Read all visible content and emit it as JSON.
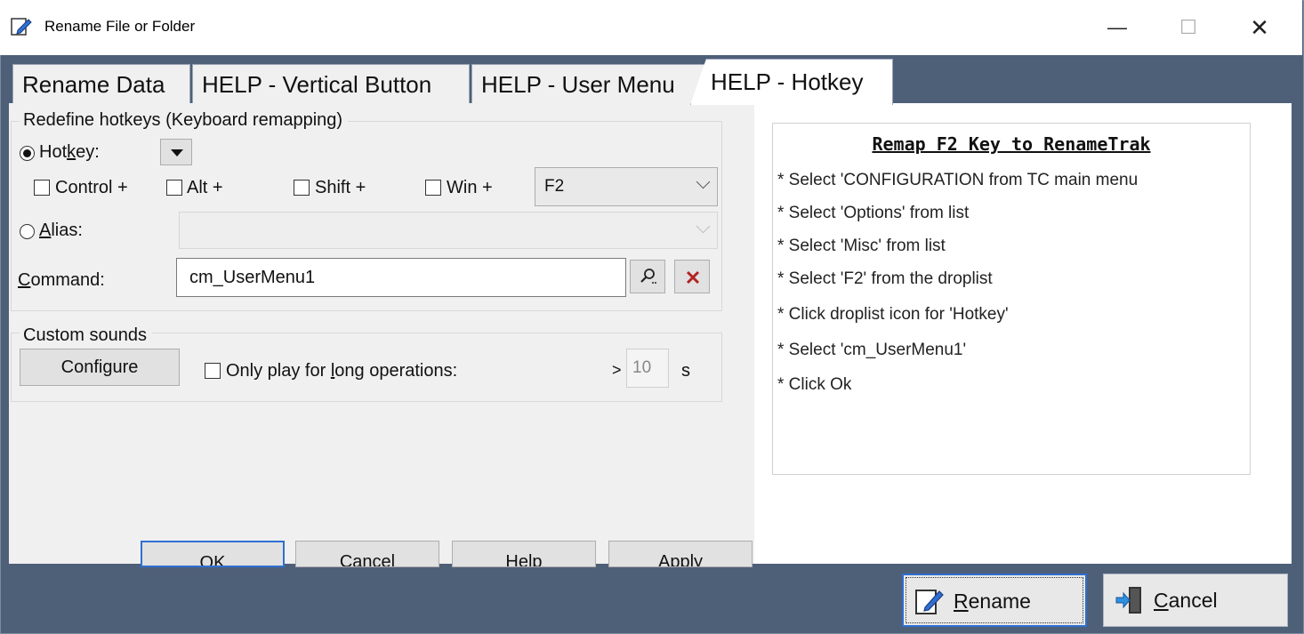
{
  "window": {
    "title": "Rename File or Folder",
    "controls": {
      "minimize": "—",
      "maximize": "☐",
      "close": "✕"
    }
  },
  "tabs": [
    {
      "label": "Rename Data",
      "active": false
    },
    {
      "label": "HELP - Vertical Button",
      "active": false
    },
    {
      "label": "HELP - User Menu",
      "active": false
    },
    {
      "label": "HELP - Hotkey",
      "active": true
    }
  ],
  "hotkeys_group": {
    "title": "Redefine hotkeys (Keyboard remapping)",
    "hotkey_radio": {
      "label_pre": "Hot",
      "label_ul": "k",
      "label_post": "ey:",
      "selected": true
    },
    "modifiers": {
      "control": "Control +",
      "alt": "Alt +",
      "shift": "Shift +",
      "win": "Win +"
    },
    "key_value": "F2",
    "alias_radio": {
      "label_ul": "A",
      "label_post": "lias:",
      "selected": false
    },
    "alias_value": "",
    "command": {
      "label_ul": "C",
      "label_post": "ommand:",
      "value": "cm_UserMenu1"
    }
  },
  "sounds_group": {
    "title": "Custom sounds",
    "configure_pre": "Confi",
    "configure_ul": "g",
    "configure_post": "ure",
    "only_play": {
      "pre": "Only play for ",
      "ul": "l",
      "post": "ong operations:"
    },
    "gt": ">",
    "seconds_value": "10",
    "seconds_unit": "s"
  },
  "dialog_buttons": {
    "ok": "OK",
    "cancel": "Cancel",
    "help": "Help",
    "apply": "Apply"
  },
  "help": {
    "title": "Remap F2 Key to RenameTrak",
    "lines": [
      "* Select 'CONFIGURATION from TC main menu",
      "* Select 'Options' from list",
      "* Select 'Misc' from list",
      "* Select 'F2' from the droplist",
      "* Click droplist icon for 'Hotkey'",
      "* Select 'cm_UserMenu1'",
      "* Click Ok"
    ]
  },
  "bottom_buttons": {
    "rename": {
      "ul": "R",
      "post": "ename"
    },
    "cancel": {
      "ul": "C",
      "post": "ancel"
    }
  },
  "colors": {
    "accent": "#2f6fd1",
    "frame": "#52637c",
    "clear_x": "#b22222"
  }
}
